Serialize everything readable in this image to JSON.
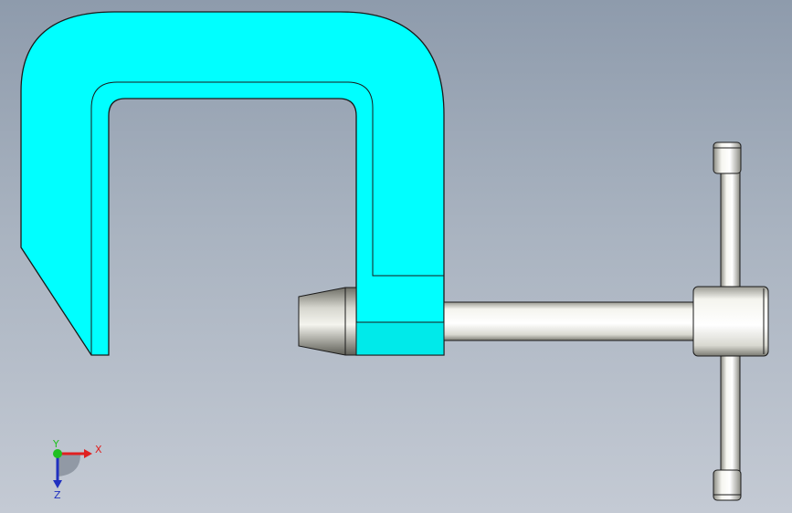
{
  "viewport": {
    "background_top": "#8e9bac",
    "background_bottom": "#c4cad4"
  },
  "model": {
    "frame_color": "#00ffff",
    "frame_edge_color": "#1a1a1a",
    "metal_color": "#e8e8e0",
    "parts": [
      "c-frame",
      "swivel-pad",
      "screw-spindle",
      "t-handle-bar",
      "handle-hub",
      "handle-caps"
    ]
  },
  "triad": {
    "x_label": "X",
    "y_label": "Y",
    "z_label": "Z",
    "x_color": "#e02020",
    "y_color": "#20c020",
    "z_color": "#2030c0"
  }
}
